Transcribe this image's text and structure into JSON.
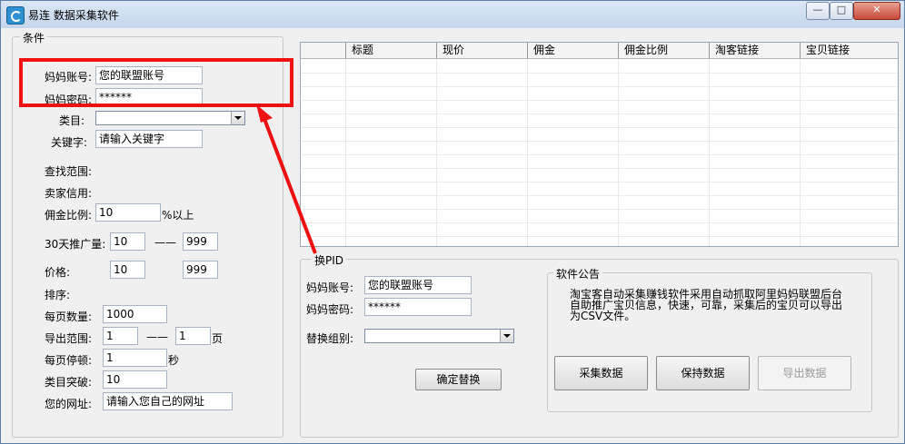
{
  "window": {
    "title": "易连 数据采集软件",
    "controls": {
      "minimize": "—",
      "maximize": "□",
      "close": "✕"
    }
  },
  "conditions": {
    "group_title": "条件",
    "mama_account_label": "妈妈账号:",
    "mama_account_value": "您的联盟账号",
    "mama_password_label": "妈妈密码:",
    "mama_password_value": "******",
    "category_label": "类目:",
    "category_value": "",
    "keyword_label": "关键字:",
    "keyword_value": "请输入关键字",
    "search_range_label": "查找范围:",
    "seller_credit_label": "卖家信用:",
    "commission_rate_label": "佣金比例:",
    "commission_rate_value": "10",
    "commission_rate_suffix": "%以上",
    "promo_30d_label": "30天推广量:",
    "promo_30d_min": "10",
    "range_sep": "——",
    "promo_30d_max": "999",
    "price_label": "价格:",
    "price_min": "10",
    "price_max": "999",
    "sort_label": "排序:",
    "per_page_label": "每页数量:",
    "per_page_value": "1000",
    "export_range_label": "导出范围:",
    "export_range_from": "1",
    "export_range_to": "1",
    "page_unit": "页",
    "page_pause_label": "每页停顿:",
    "page_pause_value": "1",
    "second_unit": "秒",
    "category_breakthrough_label": "类目突破:",
    "category_breakthrough_value": "10",
    "website_label": "您的网址:",
    "website_value": "请输入您自己的网址"
  },
  "table": {
    "columns": [
      "",
      "标题",
      "现价",
      "佣金",
      "佣金比例",
      "淘客链接",
      "宝贝链接"
    ]
  },
  "replace_pid": {
    "group_title": "换PID",
    "account_label": "妈妈账号:",
    "account_value": "您的联盟账号",
    "password_label": "妈妈密码:",
    "password_value": "******",
    "group_label": "替换组别:",
    "group_value": "",
    "confirm_button": "确定替换"
  },
  "notice": {
    "group_title": "软件公告",
    "text": "淘宝客自动采集赚钱软件采用自动抓取阿里妈妈联盟后台自助推广宝贝信息，快速，可靠，采集后的宝贝可以导出为CSV文件。",
    "collect_button": "采集数据",
    "save_button": "保持数据",
    "export_button": "导出数据"
  },
  "annotation": {
    "color": "#ee1111"
  }
}
